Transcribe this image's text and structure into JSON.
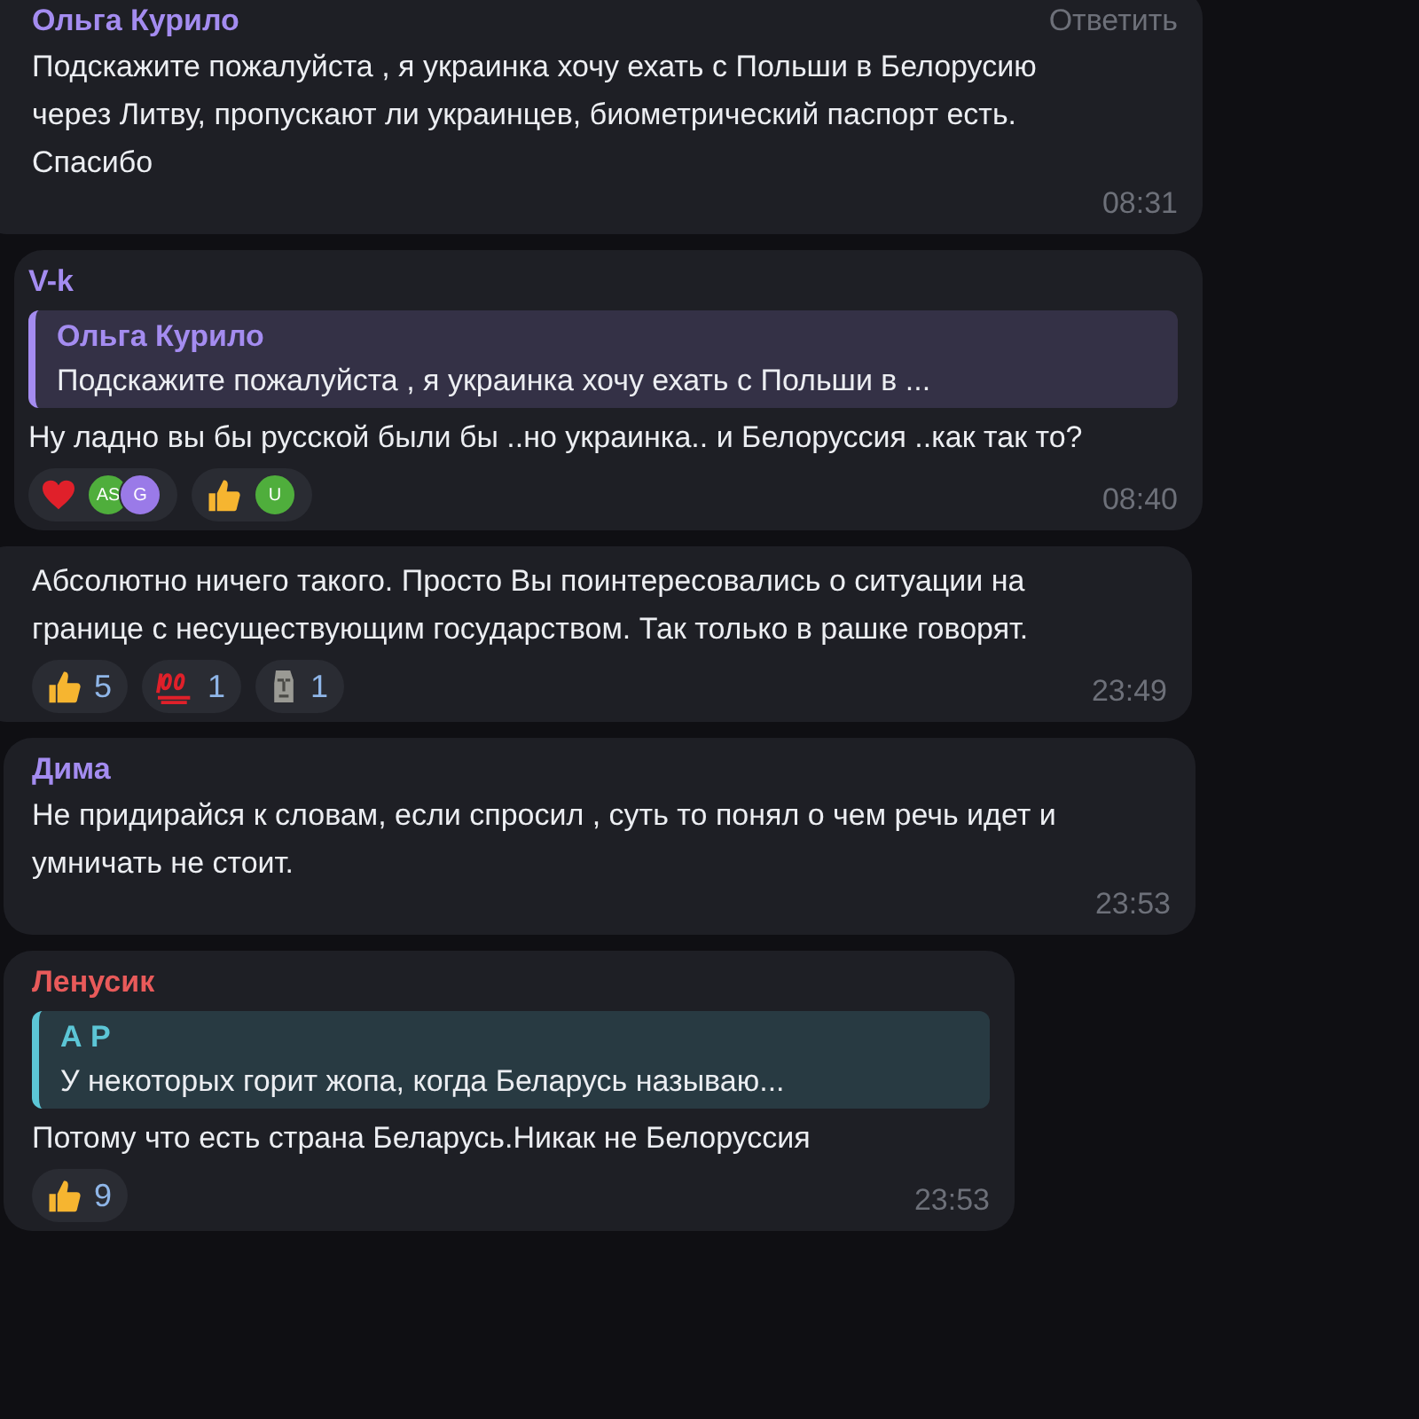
{
  "messages": [
    {
      "author": "Ольга Курило",
      "color": "#a48cf0",
      "reply_link": "Ответить",
      "text": "Подскажите пожалуйста , я украинка хочу ехать с Польши в Белорусию через Литву, пропускают ли украинцев, биометрический паспорт есть. Спасибо",
      "time": "08:31"
    },
    {
      "author": "V-k",
      "color": "#a48cf0",
      "quote": {
        "author": "Ольга Курило",
        "color": "#a48cf0",
        "text": "Подскажите пожалуйста , я украинка хочу ехать с Польши в ..."
      },
      "text": "Ну ладно вы бы русской были бы ..но украинка.. и Белоруссия ..как так то?",
      "reactions": [
        {
          "kind": "heart",
          "avatars": [
            {
              "initials": "AS",
              "color": "#4fae3c"
            },
            {
              "initials": "G",
              "color": "#9a7ae8"
            }
          ]
        },
        {
          "kind": "thumbs_up",
          "avatars": [
            {
              "initials": "U",
              "color": "#4fae3c"
            }
          ]
        }
      ],
      "time": "08:40"
    },
    {
      "text": "Абсолютно ничего такого. Просто Вы поинтересовались о ситуации на границе с несуществующим государством. Так только в рашке говорят.",
      "reactions": [
        {
          "kind": "thumbs_up",
          "count": "5"
        },
        {
          "kind": "hundred",
          "count": "1"
        },
        {
          "kind": "moai",
          "count": "1"
        }
      ],
      "time": "23:49"
    },
    {
      "author": "Дима",
      "color": "#a48cf0",
      "text": "Не придирайся к словам, если спросил , суть то понял о чем речь идет и умничать не стоит.",
      "time": "23:53"
    },
    {
      "author": "Ленусик",
      "color": "#e85a5a",
      "quote": {
        "author": "А Р",
        "color": "#5cc6d6",
        "text": "У некоторых горит жопа, когда Беларусь называю..."
      },
      "text": "Потому что есть страна Беларусь.Никак не Белоруссия",
      "reactions": [
        {
          "kind": "thumbs_up",
          "count": "9"
        }
      ],
      "time": "23:53"
    }
  ]
}
